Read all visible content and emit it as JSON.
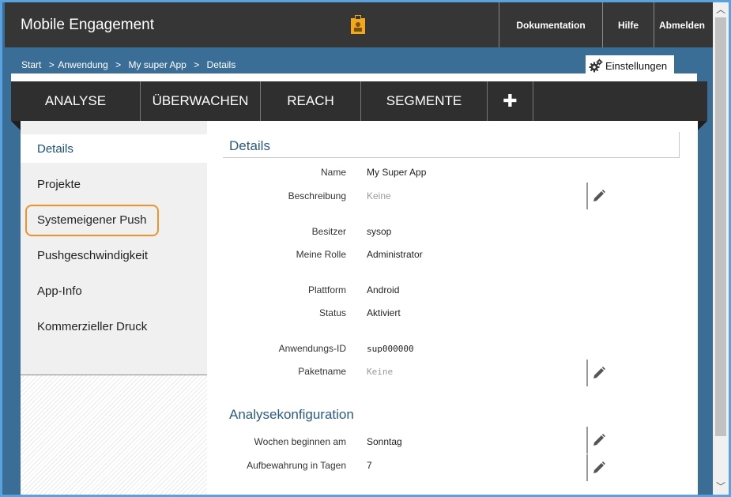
{
  "header": {
    "title": "Mobile Engagement",
    "nav": [
      "Dokumentation",
      "Hilfe",
      "Abmelden"
    ]
  },
  "breadcrumb": [
    "Start",
    ">",
    "Anwendung",
    ">",
    "My super App",
    ">",
    "Details"
  ],
  "settings_label": "Einstellungen",
  "tabs": [
    "ANALYSE",
    "ÜBERWACHEN",
    "REACH",
    "SEGMENTE"
  ],
  "add_tab": "✚",
  "sidebar": {
    "items": [
      "Details",
      "Projekte",
      "Systemeigener Push",
      "Pushgeschwindigkeit",
      "App-Info",
      "Kommerzieller Druck"
    ],
    "active": "Details",
    "highlighted": "Systemeigener Push"
  },
  "details": {
    "title": "Details",
    "name_label": "Name",
    "name_value": "My Super App",
    "desc_label": "Beschreibung",
    "desc_value": "Keine",
    "owner_label": "Besitzer",
    "owner_value": "sysop",
    "role_label": "Meine Rolle",
    "role_value": "Administrator",
    "platform_label": "Plattform",
    "platform_value": "Android",
    "status_label": "Status",
    "status_value": "Aktiviert",
    "appid_label": "Anwendungs-ID",
    "appid_value": "sup000000",
    "package_label": "Paketname",
    "package_value": "Keine"
  },
  "analytics": {
    "title": "Analysekonfiguration",
    "week_label": "Wochen beginnen am",
    "week_value": "Sonntag",
    "retention_label": "Aufbewahrung in Tagen",
    "retention_value": "7"
  },
  "colors": {
    "background": "#3a6e96",
    "header": "#363636",
    "accent_title": "#2c5a82",
    "highlight": "#f0922b",
    "frame": "#5aa1e0"
  }
}
